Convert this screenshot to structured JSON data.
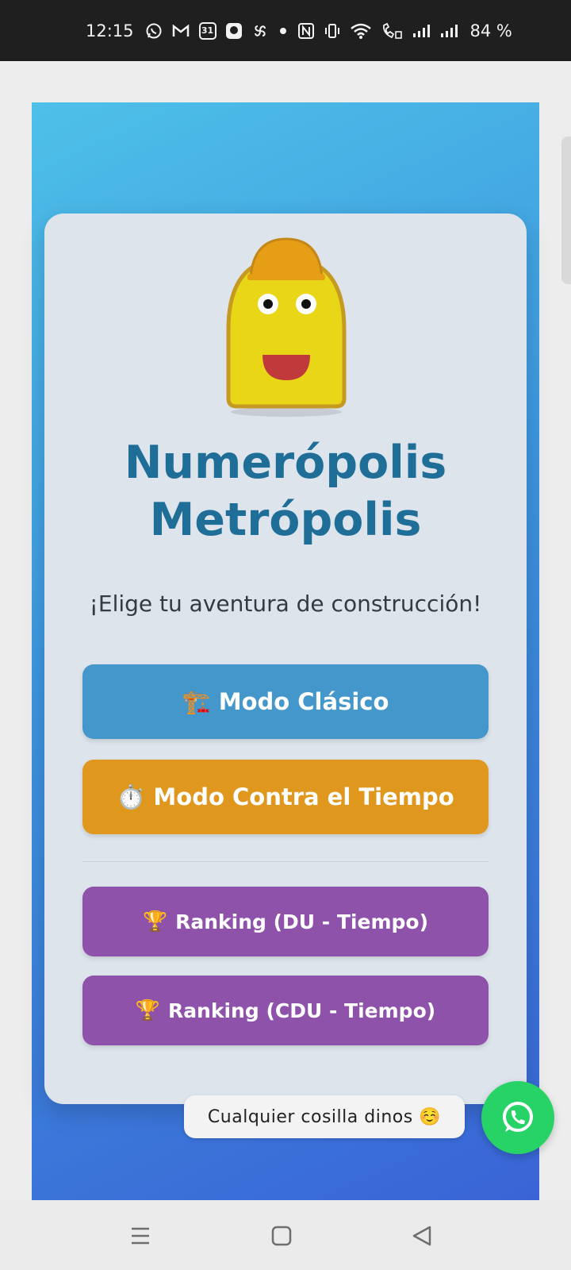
{
  "status_bar": {
    "time": "12:15",
    "battery": "84 %",
    "icons": [
      "whatsapp-icon",
      "gmail-icon",
      "calendar-icon",
      "app-icon",
      "pinwheel-icon",
      "dot-icon",
      "nfc-icon",
      "vibrate-icon",
      "wifi-icon",
      "wifi-call-icon",
      "signal-icon",
      "signal-icon"
    ],
    "calendar_day": "31"
  },
  "app": {
    "title": "Numerópolis Metrópolis",
    "subtitle": "¡Elige tu aventura de construcción!",
    "buttons": {
      "classic": {
        "emoji": "🏗️",
        "label": "Modo Clásico"
      },
      "time": {
        "emoji": "⏱️",
        "label": "Modo Contra el Tiempo"
      },
      "ranking_du": {
        "emoji": "🏆",
        "label": "Ranking (DU - Tiempo)"
      },
      "ranking_cdu": {
        "emoji": "🏆",
        "label": "Ranking (CDU - Tiempo)"
      }
    },
    "colors": {
      "title": "#1f6e98",
      "classic": "#4497ca",
      "time": "#df981d",
      "ranking": "#8e52ab",
      "whatsapp": "#27d366"
    }
  },
  "whatsapp": {
    "tooltip": "Cualquier cosilla dinos ☺️"
  },
  "nav_bar": {
    "icons": [
      "menu-icon",
      "home-icon",
      "back-icon"
    ]
  }
}
